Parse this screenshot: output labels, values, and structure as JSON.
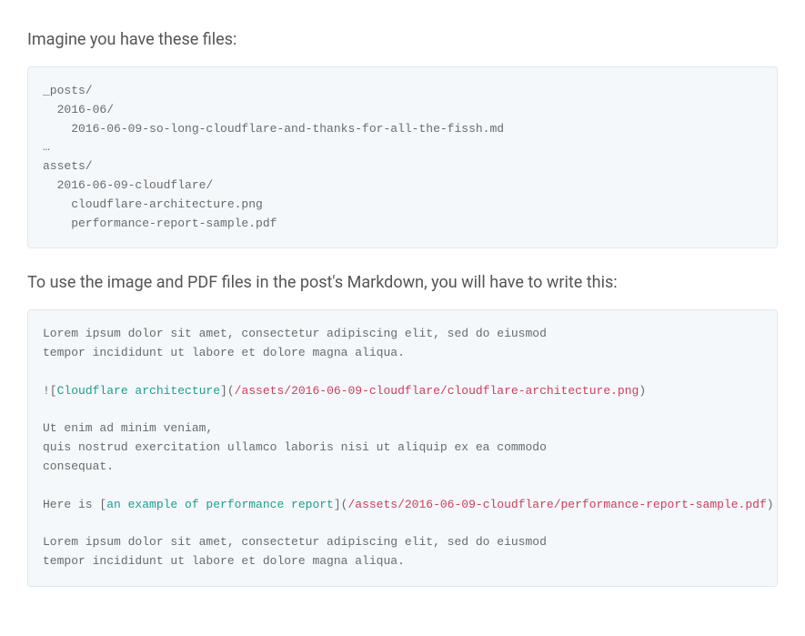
{
  "paragraphs": {
    "intro": "Imagine you have these files:",
    "mid": "To use the image and PDF files in the post's Markdown, you will have to write this:"
  },
  "code1": {
    "l1": "_posts/",
    "l2": "  2016-06/",
    "l3": "    2016-06-09-so-long-cloudflare-and-thanks-for-all-the-fissh.md",
    "l4": "…",
    "l5": "assets/",
    "l6": "  2016-06-09-cloudflare/",
    "l7": "    cloudflare-architecture.png",
    "l8": "    performance-report-sample.pdf"
  },
  "code2": {
    "p1l1": "Lorem ipsum dolor sit amet, consectetur adipiscing elit, sed do eiusmod",
    "p1l2": "tempor incididunt ut labore et dolore magna aliqua.",
    "img_prefix": "![",
    "img_alt": "Cloudflare architecture",
    "img_mid": "](",
    "img_path": "/assets/2016-06-09-cloudflare/cloudflare-architecture.png",
    "img_suffix": ")",
    "p2l1": "Ut enim ad minim veniam,",
    "p2l2": "quis nostrud exercitation ullamco laboris nisi ut aliquip ex ea commodo",
    "p2l3": "consequat.",
    "link_prefix": "Here is [",
    "link_text": "an example of performance report",
    "link_mid": "](",
    "link_path": "/assets/2016-06-09-cloudflare/performance-report-sample.pdf",
    "link_suffix": ")",
    "p3l1": "Lorem ipsum dolor sit amet, consectetur adipiscing elit, sed do eiusmod",
    "p3l2": "tempor incididunt ut labore et dolore magna aliqua."
  }
}
